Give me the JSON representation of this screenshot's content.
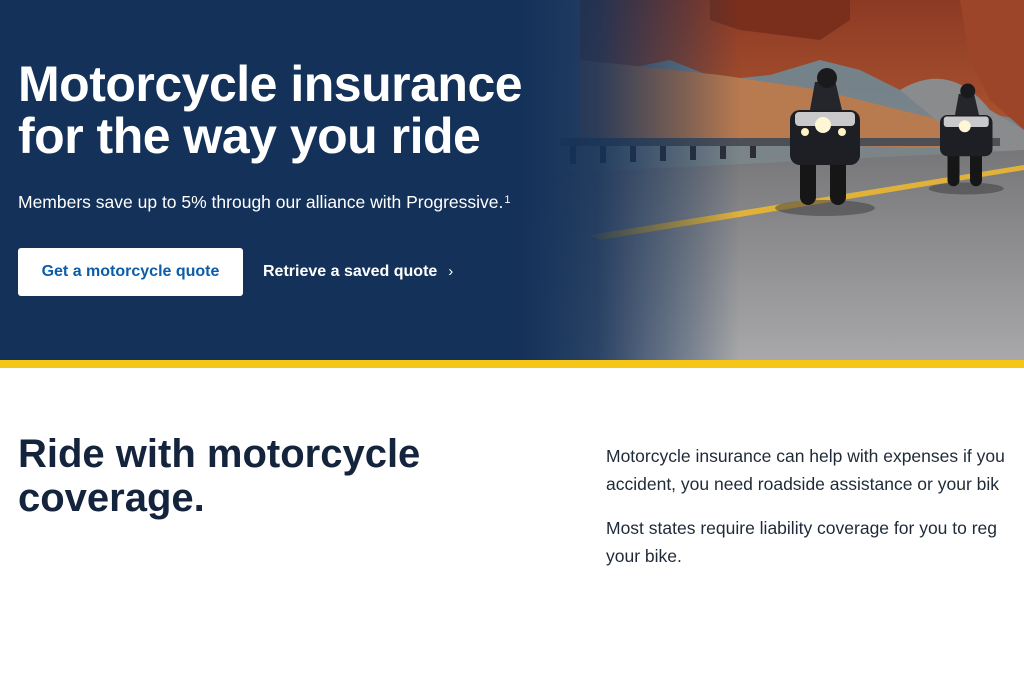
{
  "hero": {
    "title_line1": "Motorcycle insurance",
    "title_line2": "for the way you ride",
    "subtitle": "Members save up to 5% through our alliance with Progressive.",
    "footnote_mark": "1",
    "primary_button_label": "Get a motorcycle quote",
    "secondary_link_label": "Retrieve a saved quote",
    "secondary_link_icon": "chevron-right-icon",
    "background_color": "#143159",
    "photo": "Two motorcyclists with headlights on riding a curving road through red rock canyon country"
  },
  "accent_stripe_color": "#F5C518",
  "coverage": {
    "title_line1": "Ride with motorcycle",
    "title_line2": "coverage.",
    "paragraph1_line1": "Motorcycle insurance can help with expenses if you",
    "paragraph1_line2": "accident, you need roadside assistance or your bik",
    "paragraph2_line1": "Most states require liability coverage for you to reg",
    "paragraph2_line2": "your bike."
  }
}
